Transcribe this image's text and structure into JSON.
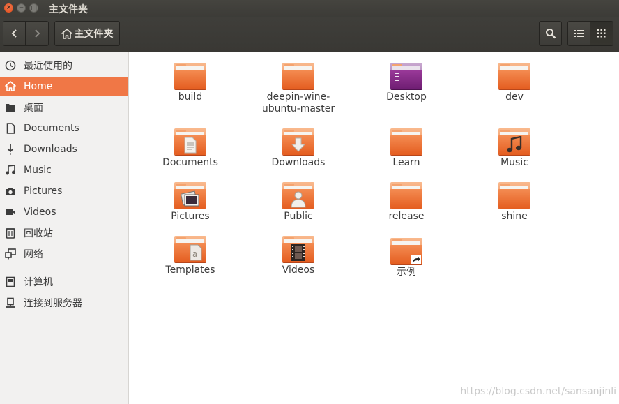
{
  "window": {
    "title": "主文件夹",
    "buttons": {
      "close": "×",
      "minimize": "−",
      "maximize": "□"
    }
  },
  "toolbar": {
    "back_icon": "chevron-left-icon",
    "forward_icon": "chevron-right-icon",
    "path_label": "主文件夹",
    "path_icon": "home-icon",
    "search_icon": "search-icon",
    "list_view_icon": "list-icon",
    "grid_view_icon": "grid-icon"
  },
  "sidebar": {
    "items": [
      {
        "label": "最近使用的",
        "icon": "clock-icon"
      },
      {
        "label": "Home",
        "icon": "home-icon",
        "active": true
      },
      {
        "label": "桌面",
        "icon": "folder-icon"
      },
      {
        "label": "Documents",
        "icon": "document-icon"
      },
      {
        "label": "Downloads",
        "icon": "download-icon"
      },
      {
        "label": "Music",
        "icon": "music-icon"
      },
      {
        "label": "Pictures",
        "icon": "camera-icon"
      },
      {
        "label": "Videos",
        "icon": "video-icon"
      },
      {
        "label": "回收站",
        "icon": "trash-icon"
      },
      {
        "label": "网络",
        "icon": "network-icon"
      },
      {
        "label": "计算机",
        "icon": "computer-icon"
      },
      {
        "label": "连接到服务器",
        "icon": "server-icon"
      }
    ]
  },
  "files": [
    {
      "name": "build",
      "emblem": "none"
    },
    {
      "name": "deepin-wine-ubuntu-master",
      "label_lines": [
        "deepin-wine-",
        "ubuntu-master"
      ],
      "emblem": "none"
    },
    {
      "name": "Desktop",
      "emblem": "desktop"
    },
    {
      "name": "dev",
      "emblem": "none"
    },
    {
      "name": "Documents",
      "emblem": "document"
    },
    {
      "name": "Downloads",
      "emblem": "download"
    },
    {
      "name": "Learn",
      "emblem": "none"
    },
    {
      "name": "Music",
      "emblem": "music"
    },
    {
      "name": "Pictures",
      "emblem": "pictures"
    },
    {
      "name": "Public",
      "emblem": "person"
    },
    {
      "name": "release",
      "emblem": "none"
    },
    {
      "name": "shine",
      "emblem": "none"
    },
    {
      "name": "Templates",
      "emblem": "template"
    },
    {
      "name": "Videos",
      "emblem": "film"
    },
    {
      "name": "示例",
      "emblem": "link"
    }
  ],
  "watermark": "https://blog.csdn.net/sansanjinli",
  "colors": {
    "accent": "#f07746",
    "titlebar": "#3c3b37",
    "folder": "#e8672d"
  }
}
